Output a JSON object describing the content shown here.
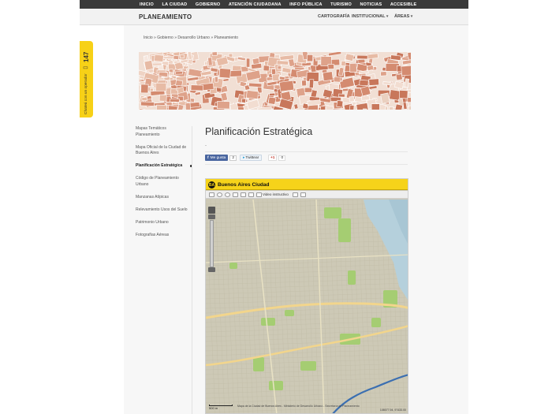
{
  "top_nav": {
    "items": [
      "INICIO",
      "LA CIUDAD",
      "GOBIERNO",
      "ATENCIÓN CIUDADANA",
      "INFO PÚBLICA",
      "TURISMO",
      "NOTICIAS",
      "ACCESIBLE"
    ]
  },
  "header": {
    "site_title": "PLANEAMIENTO",
    "nav": {
      "cartografia": "CARTOGRAFÍA",
      "institucional": "INSTITUCIONAL",
      "areas": "ÁREAS"
    }
  },
  "side_tab": {
    "label": "Chateá con un operador",
    "number": "147"
  },
  "breadcrumb": "Inicio » Gobierno » Desarrollo Urbano » Planeamiento",
  "left_nav": {
    "items": [
      {
        "label": "Mapas Temáticos Planeamiento",
        "active": false
      },
      {
        "label": "Mapa Oficial de la Ciudad de Buenos Aires",
        "active": false
      },
      {
        "label": "Planificación Estratégica",
        "active": true
      },
      {
        "label": "Código de Planeamiento Urbano",
        "active": false
      },
      {
        "label": "Manzanas Atípicas",
        "active": false
      },
      {
        "label": "Relevamiento Usos del Suelo",
        "active": false
      },
      {
        "label": "Patrimonio Urbano",
        "active": false
      },
      {
        "label": "Fotografías Aéreas",
        "active": false
      }
    ]
  },
  "main": {
    "title": "Planificación Estratégica",
    "dash": "-",
    "social": {
      "facebook_label": "Me gusta",
      "facebook_count": "2",
      "twitter_label": "Twittear",
      "gplus_label": "+1",
      "gplus_count": "0"
    }
  },
  "map": {
    "title": "Buenos Aires Ciudad",
    "logo": "BA",
    "toolbar": {
      "video_label": "Video instructivo"
    },
    "scale": "500 m",
    "attribution": "Mapa de la Ciudad de Buenos Aires - Ministerio de Desarrollo Urbano - Secretaría de Planeamiento",
    "coords": "108077.94, 97433.00",
    "colors": {
      "land": "#cdc9b6",
      "river": "#b5d0dc",
      "park": "#a5cd72",
      "avenue": "#f2d58c",
      "header": "#f6d31a"
    }
  },
  "colors": {
    "top_nav_bg": "#3a3a3a",
    "accent_yellow": "#f7d117"
  }
}
